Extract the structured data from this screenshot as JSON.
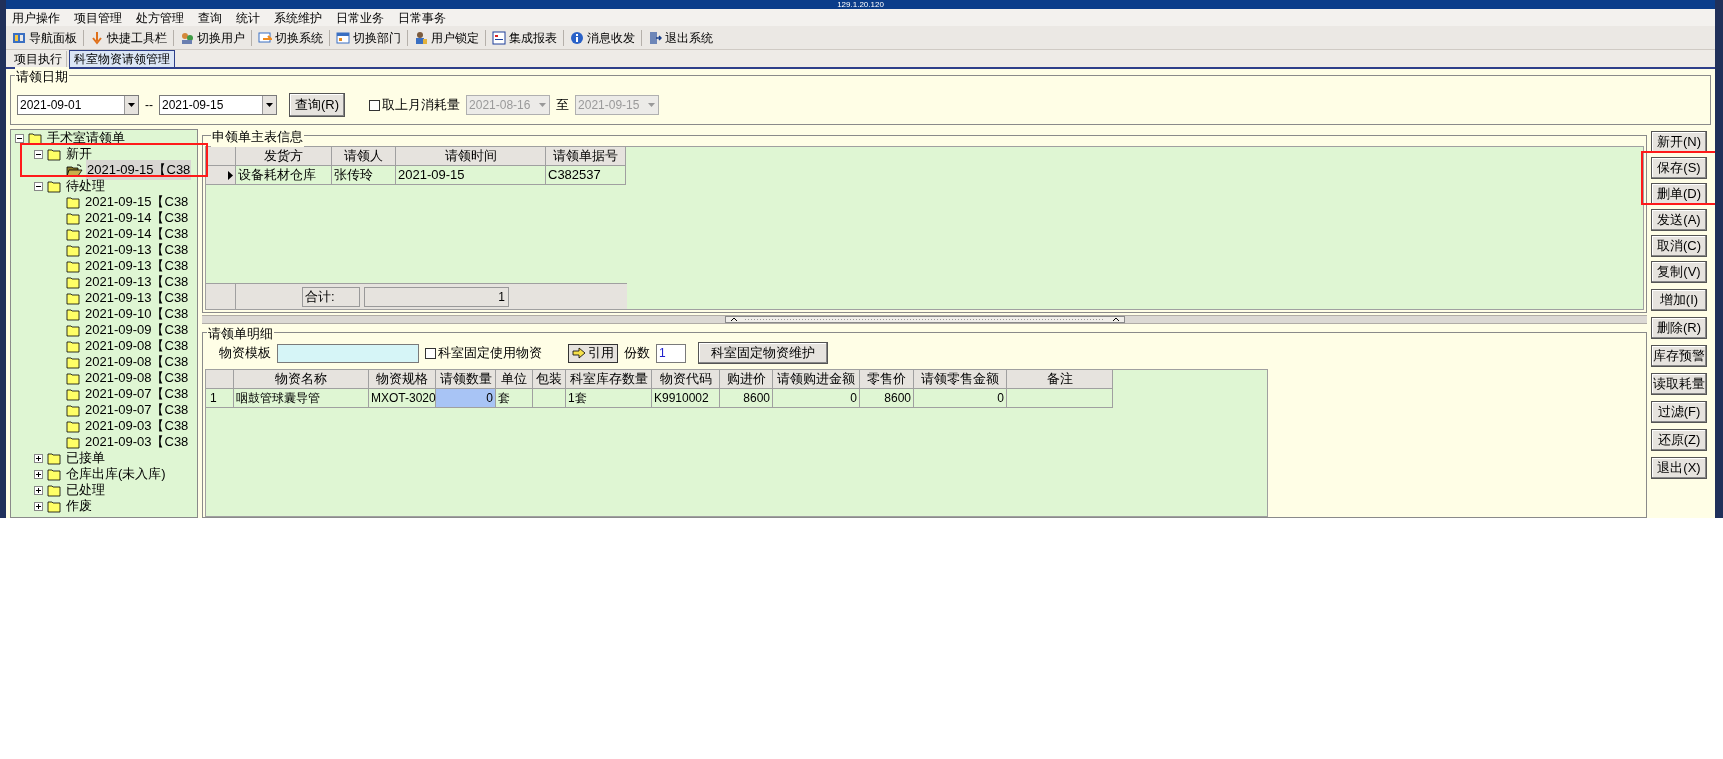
{
  "window": {
    "title": "129.1.20.120"
  },
  "menu": [
    "用户操作",
    "项目管理",
    "处方管理",
    "查询",
    "统计",
    "系统维护",
    "日常业务",
    "日常事务"
  ],
  "toolbar": [
    {
      "label": "导航面板",
      "kind": "nav"
    },
    {
      "label": "快捷工具栏",
      "kind": "quick"
    },
    {
      "label": "切换用户",
      "kind": "users"
    },
    {
      "label": "切换系统",
      "kind": "system"
    },
    {
      "label": "切换部门",
      "kind": "dept"
    },
    {
      "label": "用户锁定",
      "kind": "lock"
    },
    {
      "label": "集成报表",
      "kind": "report"
    },
    {
      "label": "消息收发",
      "kind": "info"
    },
    {
      "label": "退出系统",
      "kind": "exit"
    }
  ],
  "tabs": [
    {
      "label": "项目执行",
      "selected": false
    },
    {
      "label": "科室物资请领管理",
      "selected": true
    }
  ],
  "date_filter": {
    "title": "请领日期",
    "from": "2021-09-01",
    "separator": "--",
    "to": "2021-09-15",
    "query_button": "查询(R)",
    "last_month": {
      "label": "取上月消耗量",
      "checked": false
    },
    "last_from": "2021-08-16",
    "to_label": "至",
    "last_to": "2021-09-15",
    "last_disabled": true
  },
  "tree": {
    "label": "手术室请领单",
    "expanded": true,
    "children": [
      {
        "label": "新开",
        "expanded": true,
        "children": [
          {
            "label": "2021-09-15【C38",
            "selected": true
          }
        ]
      },
      {
        "label": "待处理",
        "expanded": true,
        "children": [
          {
            "label": "2021-09-15【C38",
            "selected": false
          },
          {
            "label": "2021-09-14【C38",
            "selected": false
          },
          {
            "label": "2021-09-14【C38",
            "selected": false
          },
          {
            "label": "2021-09-13【C38",
            "selected": false
          },
          {
            "label": "2021-09-13【C38",
            "selected": false
          },
          {
            "label": "2021-09-13【C38",
            "selected": false
          },
          {
            "label": "2021-09-13【C38",
            "selected": false
          },
          {
            "label": "2021-09-10【C38",
            "selected": false
          },
          {
            "label": "2021-09-09【C38",
            "selected": false
          },
          {
            "label": "2021-09-08【C38",
            "selected": false
          },
          {
            "label": "2021-09-08【C38",
            "selected": false
          },
          {
            "label": "2021-09-08【C38",
            "selected": false
          },
          {
            "label": "2021-09-07【C38",
            "selected": false
          },
          {
            "label": "2021-09-07【C38",
            "selected": false
          },
          {
            "label": "2021-09-03【C38",
            "selected": false
          },
          {
            "label": "2021-09-03【C38",
            "selected": false
          }
        ]
      },
      {
        "label": "已接单",
        "expanded": false
      },
      {
        "label": "仓库出库(未入库)",
        "expanded": false
      },
      {
        "label": "已处理",
        "expanded": false
      },
      {
        "label": "作废",
        "expanded": false
      }
    ]
  },
  "main_table": {
    "title": "申领单主表信息",
    "columns": [
      "发货方",
      "请领人",
      "请领时间",
      "请领单据号"
    ],
    "rows": [
      {
        "selected": true,
        "cells": [
          "设备耗材仓库",
          "张传玲",
          "2021-09-15",
          "C382537"
        ]
      }
    ],
    "footer": {
      "label": "合计:",
      "value": "1"
    }
  },
  "detail": {
    "title": "请领单明细",
    "template_label": "物资模板",
    "fixed_checkbox": {
      "label": "科室固定使用物资",
      "checked": false
    },
    "cite_button": "引用",
    "copies_label": "份数",
    "copies_value": "1",
    "maintain_button": "科室固定物资维护",
    "columns": [
      "物资名称",
      "物资规格",
      "请领数量",
      "单位",
      "包装",
      "科室库存数量",
      "物资代码",
      "购进价",
      "请领购进金额",
      "零售价",
      "请领零售金额",
      "备注"
    ],
    "rows": [
      {
        "number": "1",
        "cells": [
          {
            "text": "咽鼓管球囊导管",
            "selected": false
          },
          {
            "text": "MXOT-3020",
            "selected": false
          },
          {
            "text": "0",
            "selected": true
          },
          {
            "text": "套",
            "selected": false
          },
          {
            "text": null,
            "selected": false
          },
          {
            "text": "1套",
            "selected": false
          },
          {
            "text": "K9910002",
            "selected": false
          },
          {
            "text": "8600",
            "selected": false
          },
          {
            "text": "0",
            "selected": false
          },
          {
            "text": "8600",
            "selected": false
          },
          {
            "text": "0",
            "selected": false
          },
          {
            "text": null,
            "selected": false
          }
        ]
      }
    ]
  },
  "side_button_groups": [
    [
      "新开(N)",
      "保存(S)",
      "删单(D)",
      "发送(A)",
      "取消(C)",
      "复制(V)"
    ],
    [
      "增加(I)"
    ],
    [
      "删除(R)"
    ],
    [
      "库存预警"
    ],
    [
      "读取耗量"
    ],
    [
      "过滤(F)"
    ],
    [
      "还原(Z)"
    ],
    [
      "退出(X)"
    ]
  ]
}
